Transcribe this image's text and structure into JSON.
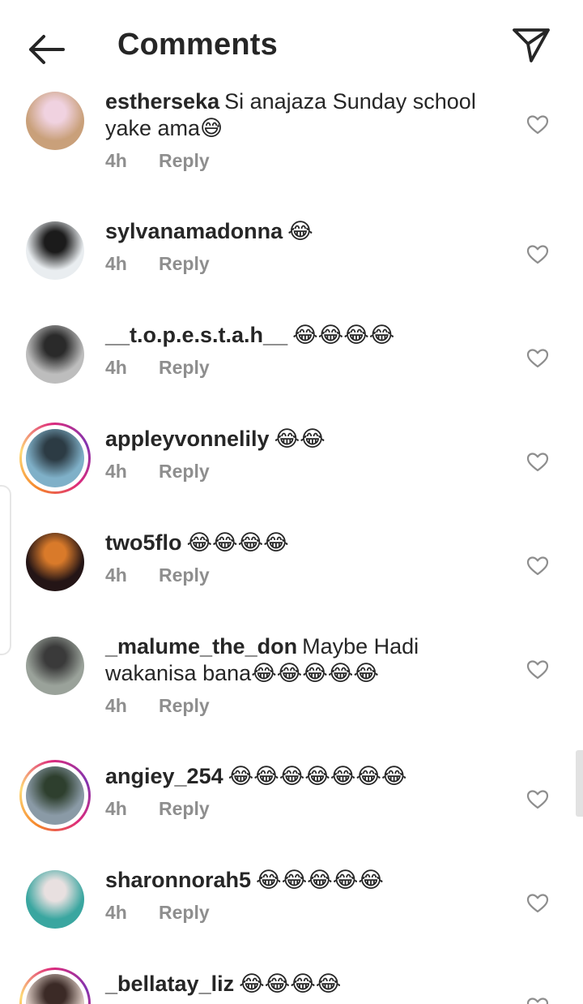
{
  "header": {
    "title": "Comments",
    "back_icon": "arrow-left-icon",
    "send_icon": "paper-plane-icon"
  },
  "reply_label": "Reply",
  "comments": [
    {
      "username": "estherseka",
      "text": "Si anajaza Sunday school yake ama😅",
      "time": "4h",
      "story": false,
      "avatar_colors": [
        "#c9a07a",
        "#f0d2e0"
      ]
    },
    {
      "username": "sylvanamadonna",
      "text": "😂",
      "time": "4h",
      "story": false,
      "avatar_colors": [
        "#e9edf0",
        "#1b1b1b"
      ]
    },
    {
      "username": "__t.o.p.e.s.t.a.h__",
      "text": "😂😂😂😂",
      "time": "4h",
      "story": false,
      "avatar_colors": [
        "#bdbdbd",
        "#2a2a2a"
      ]
    },
    {
      "username": "appleyvonnelily",
      "text": "😂😂",
      "time": "4h",
      "story": true,
      "avatar_colors": [
        "#7fb0c8",
        "#2c3b44"
      ]
    },
    {
      "username": "two5flo",
      "text": "😂😂😂😂",
      "time": "4h",
      "story": false,
      "avatar_colors": [
        "#241516",
        "#d97a2a"
      ]
    },
    {
      "username": "_malume_the_don",
      "text": "Maybe Hadi wakanisa bana😂😂😂😂😂",
      "time": "4h",
      "story": false,
      "avatar_colors": [
        "#9aa29a",
        "#3a3a3a"
      ]
    },
    {
      "username": "angiey_254",
      "text": "😂😂😂😂😂😂😂",
      "time": "4h",
      "story": true,
      "avatar_colors": [
        "#8a9aa6",
        "#2e3f2e"
      ]
    },
    {
      "username": "sharonnorah5",
      "text": "😂😂😂😂😂",
      "time": "4h",
      "story": false,
      "avatar_colors": [
        "#3aa6a0",
        "#e8e0e0"
      ]
    },
    {
      "username": "_bellatay_liz",
      "text": "😂😂😂😂",
      "time": "",
      "story": true,
      "avatar_colors": [
        "#d9c8c0",
        "#3b2a26"
      ]
    }
  ]
}
